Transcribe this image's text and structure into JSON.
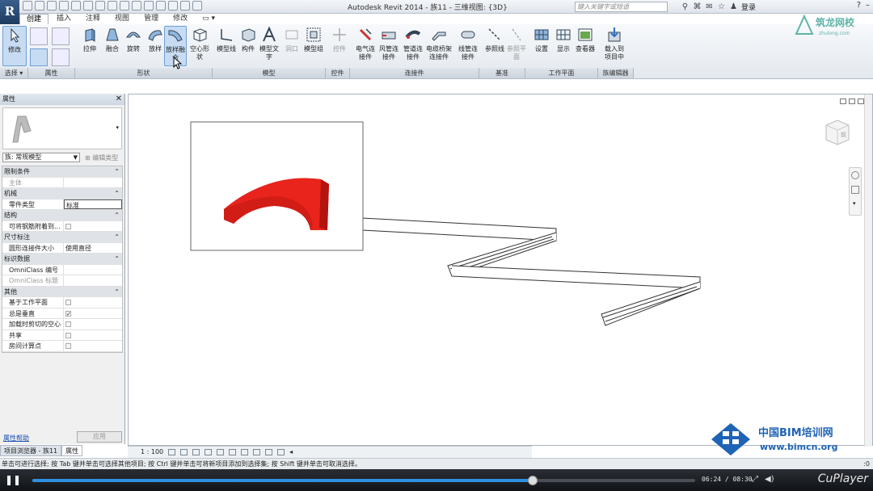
{
  "window": {
    "title": "Autodesk Revit 2014 -    族11 - 三维视图: {3D}",
    "search_placeholder": "键入关键字或短语",
    "login": "登录"
  },
  "tabs": [
    "创建",
    "插入",
    "注释",
    "视图",
    "管理",
    "修改"
  ],
  "ribbon": {
    "buttons": [
      {
        "label": "修改"
      },
      {
        "label": "拉伸"
      },
      {
        "label": "融合"
      },
      {
        "label": "旋转"
      },
      {
        "label": "放样"
      },
      {
        "label": "放样融合"
      },
      {
        "label": "空心形状"
      },
      {
        "label": "模型线"
      },
      {
        "label": "构件"
      },
      {
        "label": "模型文字"
      },
      {
        "label": "洞口"
      },
      {
        "label": "模型组"
      },
      {
        "label": "控件"
      },
      {
        "label": "电气连接件"
      },
      {
        "label": "风管连接件"
      },
      {
        "label": "管道连接件"
      },
      {
        "label": "电缆桥架连接件"
      },
      {
        "label": "线管连接件"
      },
      {
        "label": "参照线"
      },
      {
        "label": "参照平面"
      },
      {
        "label": "设置"
      },
      {
        "label": "显示"
      },
      {
        "label": "查看器"
      },
      {
        "label": "载入到项目中"
      }
    ],
    "panels": [
      "选择 ▾",
      "属性",
      "形状",
      "模型",
      "控件",
      "连接件",
      "基准",
      "工作平面",
      "族编辑器"
    ]
  },
  "properties": {
    "title": "属性",
    "family_label": "族: 常规模型",
    "edit_type": "编辑类型",
    "rows": [
      {
        "cat": true,
        "k": "限制条件"
      },
      {
        "k": "主体",
        "v": "",
        "dim": true
      },
      {
        "cat": true,
        "k": "机械"
      },
      {
        "k": "零件类型",
        "v": "标准"
      },
      {
        "cat": true,
        "k": "结构"
      },
      {
        "k": "可将钢筋附着到...",
        "cb": false
      },
      {
        "cat": true,
        "k": "尺寸标注"
      },
      {
        "k": "圆形连接件大小",
        "v": "使用直径"
      },
      {
        "cat": true,
        "k": "标识数据"
      },
      {
        "k": "OmniClass 编号",
        "v": ""
      },
      {
        "k": "OmniClass 标题",
        "v": "",
        "dim": true
      },
      {
        "cat": true,
        "k": "其他"
      },
      {
        "k": "基于工作平面",
        "cb": false
      },
      {
        "k": "总是垂直",
        "cb": true
      },
      {
        "k": "加载时剪切的空心",
        "cb": false
      },
      {
        "k": "共享",
        "cb": false
      },
      {
        "k": "房间计算点",
        "cb": false
      }
    ],
    "help": "属性帮助",
    "apply": "应用"
  },
  "bottom_tabs": [
    "项目浏览器 - 族11",
    "属性"
  ],
  "view_control": {
    "scale": "1 : 100"
  },
  "status": "单击可进行选择; 按 Tab 键并单击可选择其他项目; 按 Ctrl 键并单击可将新项目添加到选择集; 按 Shift 键并单击可取消选择。",
  "status_right": ":0",
  "player": {
    "time": "06:24 / 08:30",
    "brand": "CuPlayer",
    "progress": 0.755
  },
  "watermarks": {
    "top": "筑龙网校",
    "top_sub": "zhulong.com",
    "bim_cn": "中国BIM培训网",
    "bim_url": "www.bimcn.org"
  },
  "colors": {
    "accent": "#2f8fe0",
    "shape_red": "#e8241c",
    "ribbon_active": "#c7dcf3"
  }
}
